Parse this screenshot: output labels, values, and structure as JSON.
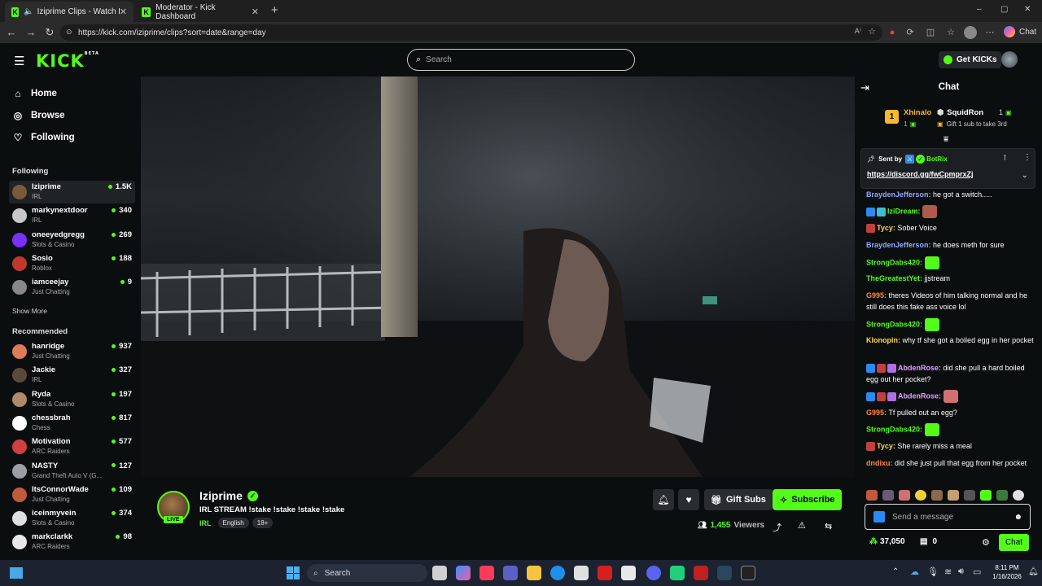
{
  "browser": {
    "tabs": [
      {
        "title": "Iziprime Clips - Watch Live on",
        "active": true
      },
      {
        "title": "Moderator - Kick Dashboard",
        "active": false
      }
    ],
    "new_tab": "+",
    "url": "https://kick.com/iziprime/clips?sort=date&range=day",
    "copilot_label": "Chat",
    "window_controls": [
      "–",
      "▢",
      "✕"
    ]
  },
  "site": {
    "logo": "KICK",
    "logo_badge": "BETA",
    "search_placeholder": "Search",
    "get_kicks": "Get KICKs"
  },
  "sidebar": {
    "nav": [
      {
        "label": "Home",
        "icon": "home-icon"
      },
      {
        "label": "Browse",
        "icon": "compass-icon"
      },
      {
        "label": "Following",
        "icon": "heart-icon"
      }
    ],
    "following_header": "Following",
    "following": [
      {
        "name": "Iziprime",
        "category": "IRL",
        "viewers": "1.5K",
        "color": "#7a5a3a"
      },
      {
        "name": "markynextdoor",
        "category": "IRL",
        "viewers": "340",
        "color": "#c8c8c8"
      },
      {
        "name": "oneeyedgregg",
        "category": "Slots & Casino",
        "viewers": "269",
        "color": "#7b2ff7"
      },
      {
        "name": "Sosio",
        "category": "Roblox",
        "viewers": "188",
        "color": "#c0392b"
      },
      {
        "name": "iamceejay",
        "category": "Just Chatting",
        "viewers": "9",
        "color": "#888888"
      }
    ],
    "show_more": "Show More",
    "recommended_header": "Recommended",
    "recommended": [
      {
        "name": "hanridge",
        "category": "Just Chatting",
        "viewers": "937",
        "color": "#e07b5a"
      },
      {
        "name": "Jackie",
        "category": "IRL",
        "viewers": "327",
        "color": "#5a4a3a"
      },
      {
        "name": "Ryda",
        "category": "Slots & Casino",
        "viewers": "197",
        "color": "#b08a6a"
      },
      {
        "name": "chessbrah",
        "category": "Chess",
        "viewers": "817",
        "color": "#ffffff"
      },
      {
        "name": "Motivation",
        "category": "ARC Raiders",
        "viewers": "577",
        "color": "#d04040"
      },
      {
        "name": "NASTY",
        "category": "Grand Theft Auto V (G...",
        "viewers": "127",
        "color": "#9aa0a6"
      },
      {
        "name": "ItsConnorWade",
        "category": "Just Chatting",
        "viewers": "109",
        "color": "#c05a3a"
      },
      {
        "name": "iceinmyvein",
        "category": "Slots & Casino",
        "viewers": "374",
        "color": "#e0e0e0"
      },
      {
        "name": "markclarkk",
        "category": "ARC Raiders",
        "viewers": "98",
        "color": "#e8e8e8"
      }
    ]
  },
  "stream": {
    "channel": "Iziprime",
    "live_badge": "LIVE",
    "title": "IRL STREAM !stake !stake !stake !stake",
    "category": "IRL",
    "tags": [
      "English",
      "18+"
    ],
    "gift_subs": "Gift Subs",
    "subscribe": "Subscribe",
    "viewers": "1,455",
    "viewers_label": "Viewers"
  },
  "chat": {
    "title": "Chat",
    "leaderboard": [
      {
        "rank": "1",
        "name": "Xhinalo",
        "count": "1"
      },
      {
        "name": "SquidRon",
        "count": "1"
      }
    ],
    "gift_hint": "Gift 1 sub to take 3rd",
    "pinned": {
      "sent_by": "Sent by",
      "author": "BotRix",
      "link": "https://discord.gg/fwCpmprxZj"
    },
    "messages": [
      {
        "user": "BraydenJefferson:",
        "text": "he got a switch.....",
        "color": "#8fa8ff"
      },
      {
        "user": "IziDream:",
        "text": "",
        "color": "#53fc18"
      },
      {
        "user": "Tycy:",
        "text": "Sober Voice",
        "color": "#ffd54f"
      },
      {
        "user": "BraydenJefferson:",
        "text": "he does meth for sure",
        "color": "#8fa8ff"
      },
      {
        "user": "StrongDabs420:",
        "text": "",
        "color": "#53fc18"
      },
      {
        "user": "TheGreatestYet:",
        "text": "jjstream",
        "color": "#53fc18"
      },
      {
        "user": "G995:",
        "text": "theres Videos of him talking normal and he still does this fake ass voice lol",
        "color": "#ff8a3d"
      },
      {
        "user": "StrongDabs420:",
        "text": "",
        "color": "#53fc18"
      },
      {
        "user": "Klonopin:",
        "text": "why tf she got a boiled egg in her pocket",
        "color": "#ffd54f"
      },
      {
        "user": "AbdenRose:",
        "text": "did she pull a hard boiled egg out her pocket?",
        "color": "#e0a0ff"
      },
      {
        "user": "AbdenRose:",
        "text": "",
        "color": "#e0a0ff"
      },
      {
        "user": "G995:",
        "text": "Tf pulled out an egg?",
        "color": "#ff8a3d"
      },
      {
        "user": "StrongDabs420:",
        "text": "",
        "color": "#53fc18"
      },
      {
        "user": "Tycy:",
        "text": "She rarely miss a meal",
        "color": "#ffd54f"
      },
      {
        "user": "dndixu:",
        "text": "did she just pull that egg from her pocket",
        "color": "#ff8a3d"
      }
    ],
    "input_placeholder": "Send a message",
    "points": "37,050",
    "drops": "0",
    "send_label": "Chat"
  },
  "taskbar": {
    "search": "Search",
    "time": "8:11 PM",
    "date": "1/16/2026"
  }
}
